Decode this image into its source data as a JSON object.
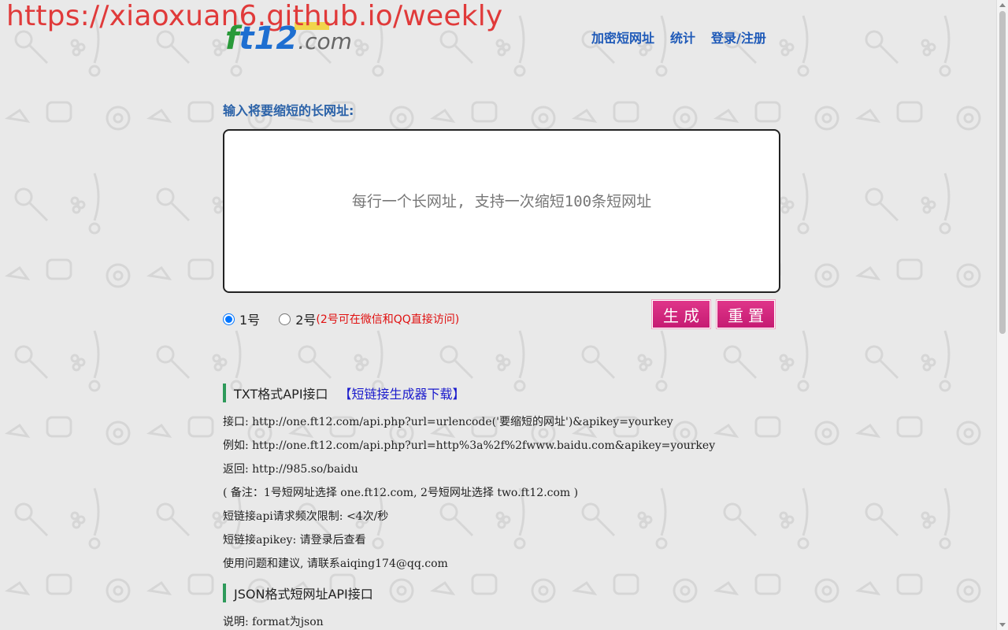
{
  "watermark": "https://xiaoxuan6.github.io/weekly",
  "logo": {
    "f": "f",
    "t": "t12",
    "com": ".com"
  },
  "nav": [
    {
      "label": "加密短网址"
    },
    {
      "label": "统计"
    },
    {
      "label": "登录/注册"
    }
  ],
  "form": {
    "label": "输入将要缩短的长网址:",
    "placeholder": "每行一个长网址, 支持一次缩短100条短网址",
    "radio1": "1号",
    "radio2": "2号",
    "radio2_note": "(2号可在微信和QQ直接访问)",
    "generate": "生成",
    "reset": "重置"
  },
  "txt_api": {
    "title": "TXT格式API接口",
    "download": "【短链接生成器下载】",
    "lines": [
      "接口: http://one.ft12.com/api.php?url=urlencode('要缩短的网址')&apikey=yourkey",
      "例如: http://one.ft12.com/api.php?url=http%3a%2f%2fwww.baidu.com&apikey=yourkey",
      "返回: http://985.so/baidu",
      "( 备注：1号短网址选择 one.ft12.com, 2号短网址选择 two.ft12.com )",
      "短链接api请求频次限制: <4次/秒",
      "短链接apikey: 请登录后查看",
      "使用问题和建议, 请联系aiqing174@qq.com"
    ]
  },
  "json_api": {
    "title": "JSON格式短网址API接口",
    "lines": [
      "说明: format为json"
    ]
  },
  "colors": {
    "accent": "#1f5ab8",
    "button": "#d3267c",
    "section_bar": "#2e9a5a",
    "note": "#e01010"
  }
}
